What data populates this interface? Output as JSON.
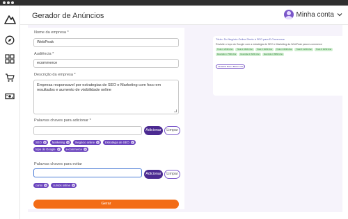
{
  "header": {
    "title": "Gerador de Anúncios",
    "account_name": "Minha conta"
  },
  "sidebar": {
    "items": [
      {
        "icon": "compass-icon"
      },
      {
        "icon": "grid-icon"
      },
      {
        "icon": "cart-icon"
      },
      {
        "icon": "money-icon"
      }
    ]
  },
  "form": {
    "company_name": {
      "label": "Nome da empresa *",
      "value": "WebPeak"
    },
    "audience": {
      "label": "Audiência *",
      "value": "ecommerce"
    },
    "description": {
      "label": "Descrição da empresa *",
      "value": "Empresa responsavel por estrategias de SEO e Marketing com foco em resultados e aumento de visibilidade online"
    },
    "keywords_add": {
      "label": "Palavras chaves para adicionar *",
      "value": "",
      "add_label": "Adicionar",
      "clear_label": "Limpar",
      "chips": [
        "SEO",
        "Marketing",
        "Negócio online",
        "Estratégia de SEO",
        "topo do Google",
        "e-commerce"
      ]
    },
    "keywords_avoid": {
      "label": "Palavras chaves para evitar",
      "value": "",
      "add_label": "Adicionar",
      "clear_label": "Limpar",
      "chips": [
        "curso",
        "cursos online"
      ]
    },
    "generate_label": "Gerar"
  },
  "preview": {
    "title": "Título: Do Negócio Online Direto à SEO para E-Commerce",
    "subtitle": "Revisite o topo do Google com a estratégia de SEO e Marketing da WebPeak para e-commerce",
    "tags": [
      "Título 1: 25/30 char",
      "Título 2: 26/30 char",
      "Título 3: 28/30 char",
      "Título 4: 30/30 char",
      "Título 5: 22/30 char",
      "Título 6: 30/30 char",
      "Descrição 1: 75/90 char",
      "Descrição 2: 82/90 char",
      "Descrição 3: 88/90 char"
    ],
    "action_label": "Visualizar Mais e Baixar Lista"
  },
  "colors": {
    "primary": "#4b2a91",
    "chip": "#6a44bd",
    "accent": "#f36c16",
    "background": "#f6f3fb"
  }
}
